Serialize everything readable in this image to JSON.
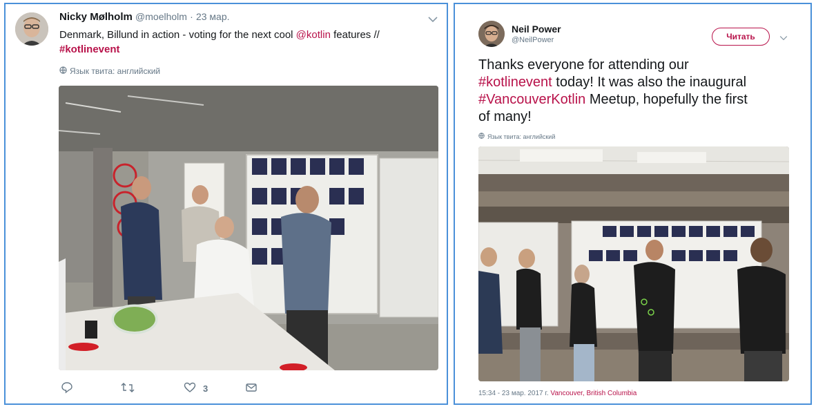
{
  "tweet1": {
    "author_name": "Nicky Mølholm",
    "handle": "@moelholm",
    "separator": "·",
    "date": "23 мар.",
    "text_part1": "Denmark, Billund in action - voting for the next cool ",
    "mention": "@kotlin",
    "text_part2": " features //",
    "hashtag": "#kotlinevent",
    "language_label": "Язык твита: английский",
    "like_count": "3"
  },
  "tweet2": {
    "author_name": "Neil Power",
    "handle": "@NeilPower",
    "follow_label": "Читать",
    "text_line1": "Thanks everyone for attending our",
    "hashtag1": "#kotlinevent",
    "text_line2_rest": " today! It was also the inaugural",
    "hashtag2": "#VancouverKotlin",
    "text_line3_rest": " Meetup, hopefully the first",
    "text_line4": "of many!",
    "language_label": "Язык твита: английский",
    "timestamp": "15:34 - 23 мар. 2017 г.",
    "location": "Vancouver, British Columbia"
  },
  "icons": {
    "reply": "reply-icon",
    "retweet": "retweet-icon",
    "like": "heart-icon",
    "dm": "message-icon",
    "caret": "chevron-down-icon",
    "globe": "globe-icon"
  },
  "colors": {
    "link": "#b8124a",
    "muted": "#657786",
    "card_border": "#4a90d9"
  }
}
